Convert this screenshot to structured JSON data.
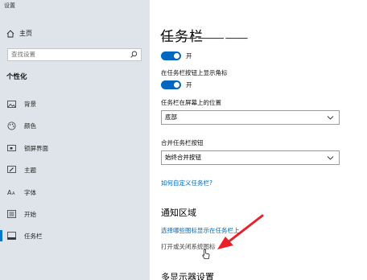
{
  "window": {
    "title": "设置"
  },
  "sidebar": {
    "home_label": "主页",
    "search_placeholder": "查找设置",
    "section_label": "个性化",
    "items": [
      {
        "label": "背景",
        "icon": "image-icon"
      },
      {
        "label": "颜色",
        "icon": "palette-icon"
      },
      {
        "label": "锁屏界面",
        "icon": "lock-screen-icon"
      },
      {
        "label": "主题",
        "icon": "theme-icon"
      },
      {
        "label": "字体",
        "icon": "font-icon"
      },
      {
        "label": "开始",
        "icon": "start-icon"
      },
      {
        "label": "任务栏",
        "icon": "taskbar-icon",
        "active": true
      }
    ]
  },
  "main": {
    "title": "任务栏",
    "toggle1": {
      "state": "开"
    },
    "badge_label": "在任务栏按钮上显示角标",
    "toggle2": {
      "state": "开"
    },
    "position_label": "任务栏在屏幕上的位置",
    "position_value": "底部",
    "combine_label": "合并任务栏按钮",
    "combine_value": "始终合并按钮",
    "customize_link": "如何自定义任务栏?",
    "notification_heading": "通知区域",
    "select_icons_link": "选择哪些图标显示在任务栏上",
    "system_icons_link": "打开或关闭系统图标",
    "multi_display_heading": "多显示器设置"
  },
  "colors": {
    "accent": "#0067c0",
    "link": "#0067b8",
    "sidebar_bg": "#dfe4ea",
    "arrow": "#e8202a"
  }
}
